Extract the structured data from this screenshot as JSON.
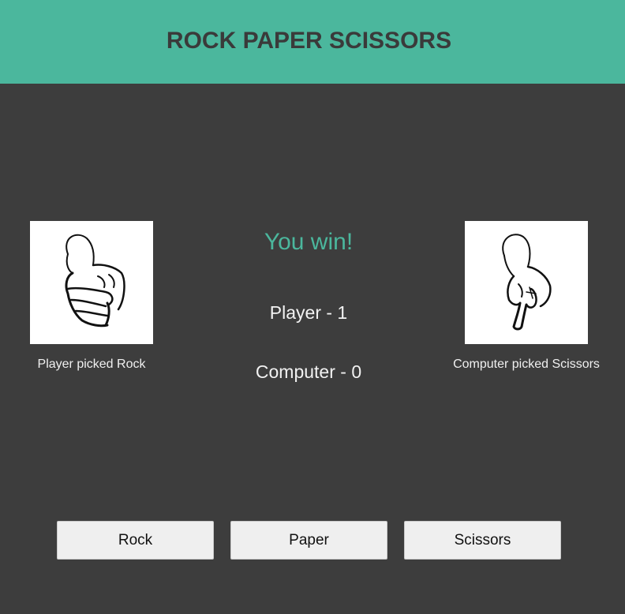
{
  "header": {
    "title": "ROCK PAPER SCISSORS"
  },
  "player": {
    "icon": "rock-hand-icon",
    "caption": "Player picked Rock"
  },
  "computer": {
    "icon": "scissors-hand-icon",
    "caption": "Computer picked Scissors"
  },
  "result": {
    "text": "You win!"
  },
  "scores": {
    "player": "Player - 1",
    "computer": "Computer - 0"
  },
  "controls": {
    "rock_label": "Rock",
    "paper_label": "Paper",
    "scissors_label": "Scissors"
  },
  "colors": {
    "accent": "#4bb79d",
    "background": "#3d3d3d",
    "header_text": "#3a3a3a"
  }
}
